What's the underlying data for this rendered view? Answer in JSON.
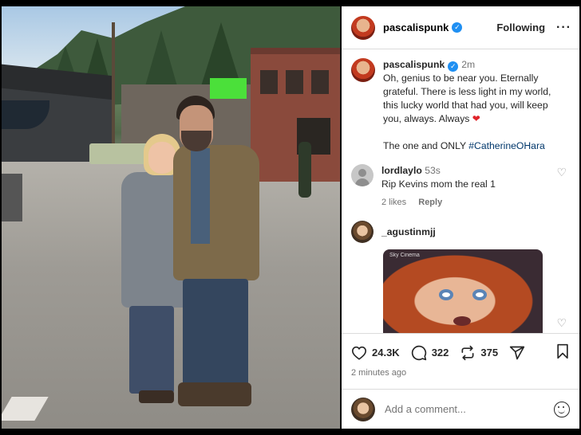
{
  "post": {
    "username": "pascalispunk",
    "follow_status": "Following",
    "more_label": "···"
  },
  "caption": {
    "username": "pascalispunk",
    "time": "2m",
    "text": "Oh, genius to be near you. Eternally grateful.  There is less light in my world, this lucky world that had you, will keep you, always.  Always",
    "emoji": "❤",
    "line2_prefix": "The one and ONLY ",
    "hashtag": "#CatherineOHara"
  },
  "comments": [
    {
      "username": "lordlaylo",
      "time": "53s",
      "text": "Rip Kevins mom the real 1",
      "likes": "2 likes",
      "reply": "Reply"
    },
    {
      "username": "_agustinmjj",
      "gif_tag": "Sky Cinema"
    }
  ],
  "actions": {
    "likes": "24.3K",
    "comments": "322",
    "reposts": "375"
  },
  "timestamp": "2 minutes ago",
  "add_comment": {
    "placeholder": "Add a comment..."
  },
  "icons": {
    "verified": "verified-badge-icon",
    "heart": "heart-icon",
    "comment": "comment-bubble-icon",
    "repost": "repost-icon",
    "share": "share-arrow-icon",
    "save": "bookmark-icon",
    "emoji": "emoji-icon"
  },
  "colors": {
    "verified": "#1f8ff2",
    "hashtag": "#00376b",
    "muted": "#737373",
    "heart": "#e0242a"
  }
}
